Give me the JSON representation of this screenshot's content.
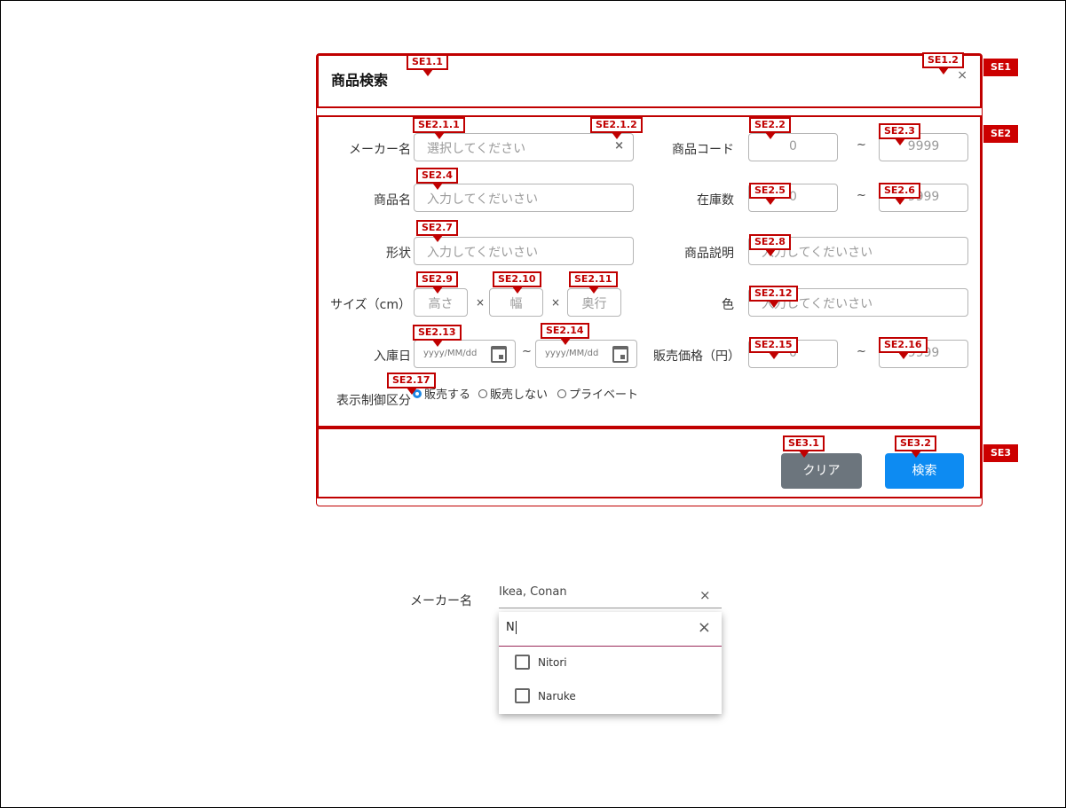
{
  "dialog": {
    "title": "商品検索",
    "close_glyph": "×"
  },
  "fields": {
    "maker_label": "メーカー名",
    "maker_placeholder": "選択してください",
    "maker_clear": "×",
    "name_label": "商品名",
    "name_placeholder": "入力してくだいさい",
    "shape_label": "形状",
    "shape_placeholder": "入力してくだいさい",
    "size_label": "サイズ（cm）",
    "size_height": "高さ",
    "size_width": "幅",
    "size_depth": "奥行",
    "size_sep": "×",
    "arrival_label": "入庫日",
    "date_placeholder": "yyyy/MM/dd",
    "range_sep": "~",
    "code_label": "商品コード",
    "code_from": "0",
    "code_to": "9999",
    "stock_label": "在庫数",
    "stock_from": "0",
    "stock_to": "9999",
    "desc_label": "商品説明",
    "desc_placeholder": "入力してくだいさい",
    "color_label": "色",
    "color_placeholder": "入力してくだいさい",
    "price_label": "販売価格（円）",
    "price_from": "0",
    "price_to": "9999",
    "display_label": "表示制御区分",
    "radio_options": [
      "販売する",
      "販売しない",
      "プライベート"
    ],
    "radio_selected": 0
  },
  "buttons": {
    "clear": "クリア",
    "search": "検索"
  },
  "section_tags": [
    "SE1",
    "SE2",
    "SE3"
  ],
  "callouts": {
    "se1_1": "SE1.1",
    "se1_2": "SE1.2",
    "se2_1_1": "SE2.1.1",
    "se2_1_2": "SE2.1.2",
    "se2_2": "SE2.2",
    "se2_3": "SE2.3",
    "se2_4": "SE2.4",
    "se2_5": "SE2.5",
    "se2_6": "SE2.6",
    "se2_7": "SE2.7",
    "se2_8": "SE2.8",
    "se2_9": "SE2.9",
    "se2_10": "SE2.10",
    "se2_11": "SE2.11",
    "se2_12": "SE2.12",
    "se2_13": "SE2.13",
    "se2_14": "SE2.14",
    "se2_15": "SE2.15",
    "se2_16": "SE2.16",
    "se2_17": "SE2.17",
    "se3_1": "SE3.1",
    "se3_2": "SE3.2"
  },
  "dropdown_demo": {
    "label": "メーカー名",
    "selected_value": "Ikea, Conan",
    "clear_glyph": "×",
    "query": "N",
    "query_clear": "×",
    "options": [
      "Nitori",
      "Naruke"
    ]
  },
  "icons": {
    "calendar": "calendar-icon",
    "close": "close-icon",
    "checkbox": "checkbox-icon",
    "radio": "radio-icon"
  },
  "colors": {
    "annotation": "#c00000",
    "primary": "#0d8bf2",
    "secondary": "#6c757d",
    "radio_on": "#1e88e5"
  }
}
